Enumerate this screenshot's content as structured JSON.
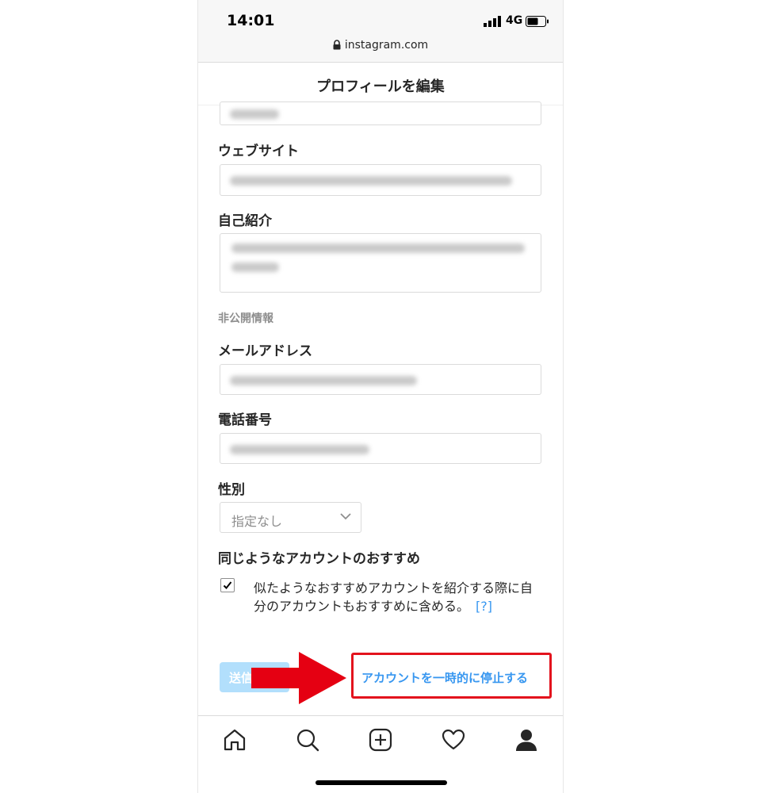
{
  "status_bar": {
    "time": "14:01",
    "network": "4G",
    "url": "instagram.com"
  },
  "header": {
    "title": "プロフィールを編集"
  },
  "form": {
    "website_label": "ウェブサイト",
    "bio_label": "自己紹介",
    "private_section_label": "非公開情報",
    "email_label": "メールアドレス",
    "phone_label": "電話番号",
    "gender_label": "性別",
    "gender_value": "指定なし",
    "recommendations_label": "同じようなアカウントのおすすめ",
    "recommendations_desc": "似たようなおすすめアカウントを紹介する際に自分のアカウントもおすすめに含める。",
    "help_link": "[?]",
    "recommendations_checked": true,
    "submit_label": "送信",
    "deactivate_label": "アカウントを一時的に停止する"
  },
  "bottom_nav": {
    "items": [
      "home-icon",
      "search-icon",
      "new-post-icon",
      "activity-heart-icon",
      "profile-icon"
    ]
  },
  "colors": {
    "link_blue": "#3897f0",
    "submit_disabled": "#b2dffc",
    "highlight_red": "#e3131d",
    "arrow_red": "#e50012"
  }
}
